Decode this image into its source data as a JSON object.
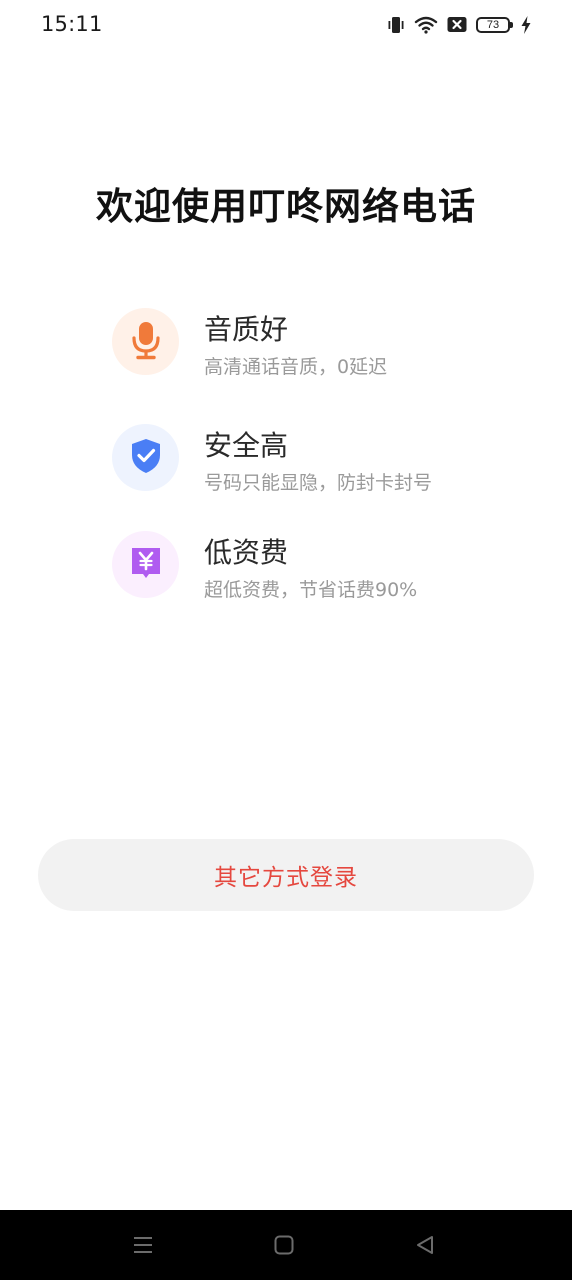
{
  "status_bar": {
    "time": "15:11",
    "battery_level": "73",
    "icons": [
      "vibrate-icon",
      "wifi-icon",
      "sim-off-icon",
      "battery-icon",
      "charging-icon"
    ]
  },
  "welcome": {
    "title": "欢迎使用叮咚网络电话"
  },
  "features": [
    {
      "icon": "microphone-icon",
      "title": "音质好",
      "desc": "高清通话音质，0延迟",
      "icon_color": "#f07a3a",
      "icon_bg": "#fff1e8"
    },
    {
      "icon": "shield-check-icon",
      "title": "安全高",
      "desc": "号码只能显隐，防封卡封号",
      "icon_color": "#4a7ef5",
      "icon_bg": "#eef3fe"
    },
    {
      "icon": "yen-icon",
      "title": "低资费",
      "desc": "超低资费，节省话费90%",
      "icon_color": "#b05cf0",
      "icon_bg": "#fbeffe"
    }
  ],
  "actions": {
    "other_login_label": "其它方式登录"
  },
  "colors": {
    "accent_text": "#e5483f",
    "button_bg": "#f2f2f2"
  },
  "nav_bar": {
    "buttons": [
      "menu-icon",
      "home-icon",
      "back-icon"
    ]
  }
}
